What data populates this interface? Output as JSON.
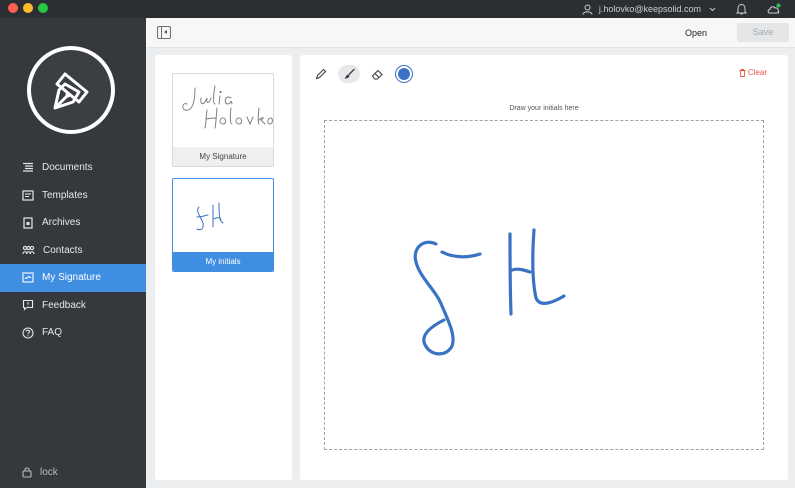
{
  "titlebar": {
    "user_email": "j.holovko@keepsolid.com"
  },
  "sidebar": {
    "items": [
      {
        "label": "Documents",
        "icon": "documents-icon"
      },
      {
        "label": "Templates",
        "icon": "templates-icon"
      },
      {
        "label": "Archives",
        "icon": "archives-icon"
      },
      {
        "label": "Contacts",
        "icon": "contacts-icon"
      },
      {
        "label": "My Signature",
        "icon": "signature-icon",
        "active": true
      },
      {
        "label": "Feedback",
        "icon": "feedback-icon"
      },
      {
        "label": "FAQ",
        "icon": "faq-icon"
      }
    ],
    "lock_label": "lock"
  },
  "toolbar": {
    "open_label": "Open",
    "save_label": "Save"
  },
  "signatures": {
    "items": [
      {
        "caption": "My Signature",
        "handwriting": "Julia Holovko",
        "selected": false
      },
      {
        "caption": "My initials",
        "handwriting": "JH",
        "selected": true
      }
    ]
  },
  "editor": {
    "clear_label": "Clear",
    "hint": "Draw your initials here",
    "pen_color": "#3a72c4",
    "accent_color": "#3f8ee2"
  }
}
